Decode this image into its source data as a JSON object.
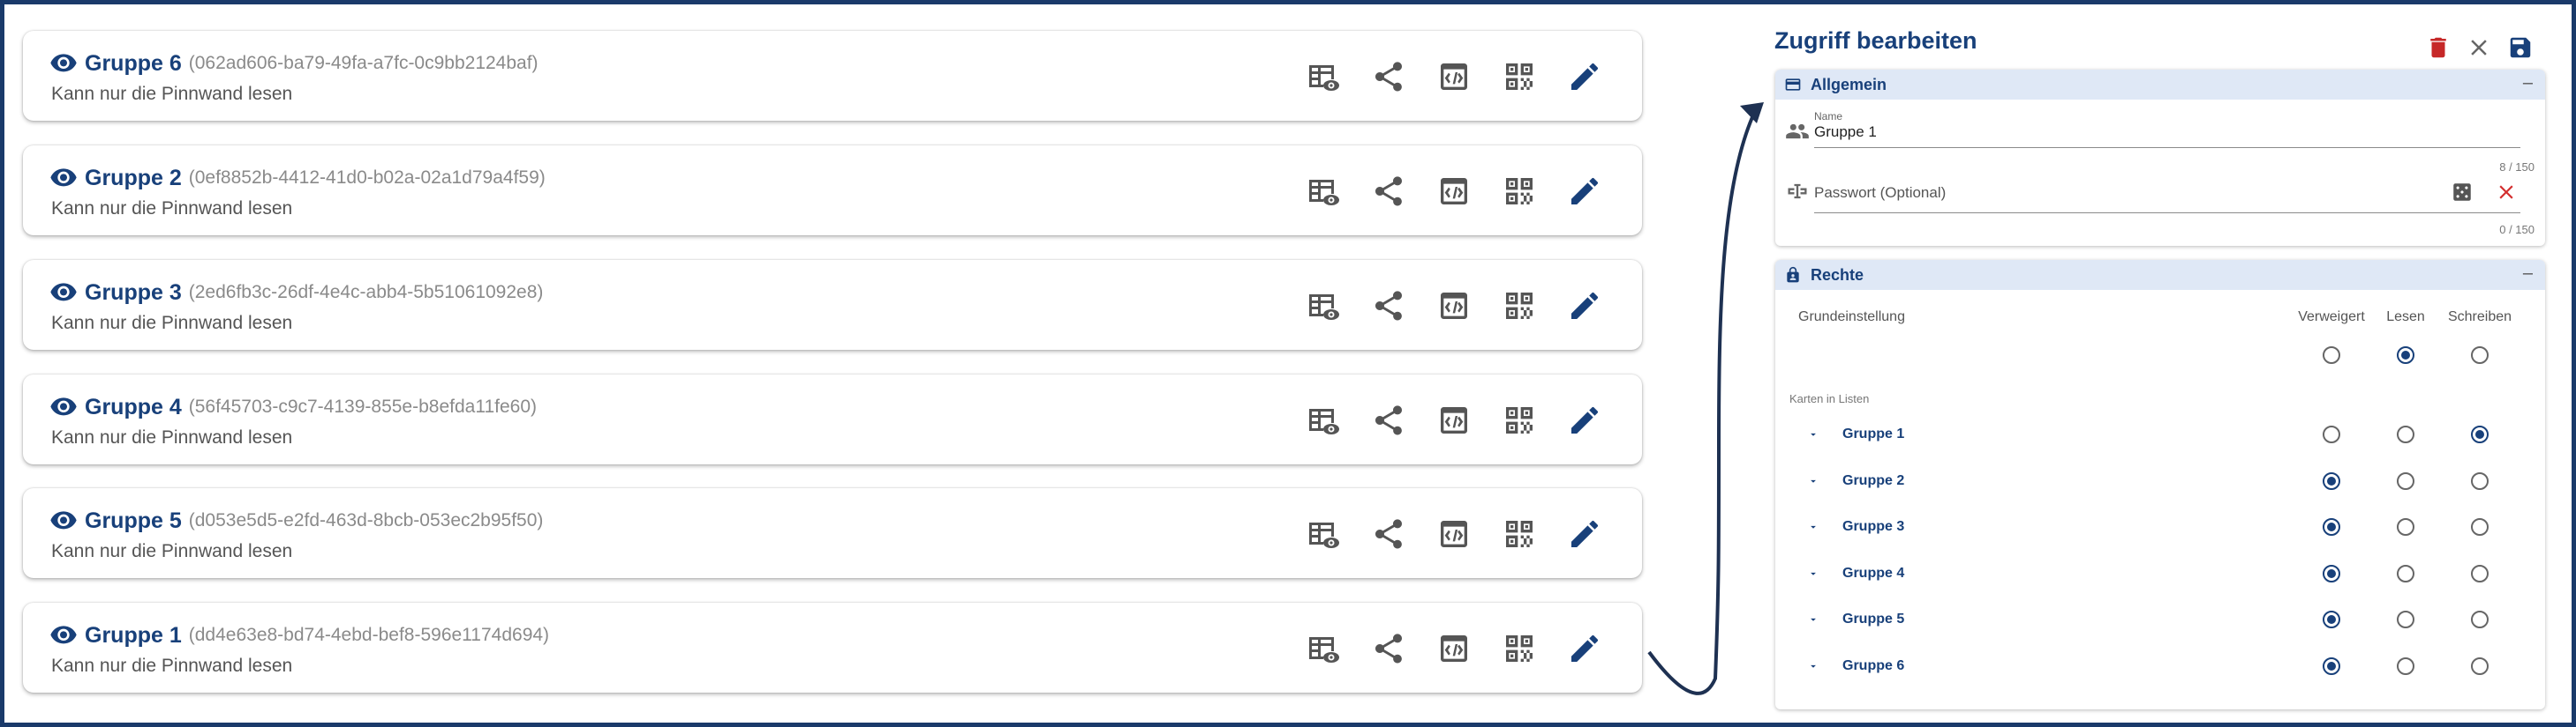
{
  "cards": [
    {
      "name": "Gruppe 6",
      "uuid": "(062ad606-ba79-49fa-a7fc-0c9bb2124baf)",
      "desc": "Kann nur die Pinnwand lesen"
    },
    {
      "name": "Gruppe 2",
      "uuid": "(0ef8852b-4412-41d0-b02a-02a1d79a4f59)",
      "desc": "Kann nur die Pinnwand lesen"
    },
    {
      "name": "Gruppe 3",
      "uuid": "(2ed6fb3c-26df-4e4c-abb4-5b51061092e8)",
      "desc": "Kann nur die Pinnwand lesen"
    },
    {
      "name": "Gruppe 4",
      "uuid": "(56f45703-c9c7-4139-855e-b8efda11fe60)",
      "desc": "Kann nur die Pinnwand lesen"
    },
    {
      "name": "Gruppe 5",
      "uuid": "(d053e5d5-e2fd-463d-8bcb-053ec2b95f50)",
      "desc": "Kann nur die Pinnwand lesen"
    },
    {
      "name": "Gruppe 1",
      "uuid": "(dd4e63e8-bd74-4ebd-bef8-596e1174d694)",
      "desc": "Kann nur die Pinnwand lesen"
    }
  ],
  "card_icons": [
    "table-eye-icon",
    "share-icon",
    "embed-code-icon",
    "qr-code-icon",
    "edit-pencil-icon"
  ],
  "panel": {
    "title": "Zugriff bearbeiten",
    "header_icons": [
      "delete-icon",
      "close-icon",
      "save-icon"
    ],
    "general": {
      "label": "Allgemein",
      "collapse": "–",
      "name_label": "Name",
      "name_value": "Gruppe 1",
      "name_counter": "8 / 150",
      "password_placeholder": "Passwort (Optional)",
      "password_counter": "0 / 150"
    },
    "rights": {
      "label": "Rechte",
      "collapse": "–",
      "default_label": "Grundeinstellung",
      "columns": [
        "Verweigert",
        "Lesen",
        "Schreiben"
      ],
      "default_selected": 1,
      "subheading": "Karten in Listen",
      "groups": [
        {
          "name": "Gruppe 1",
          "selected": 2
        },
        {
          "name": "Gruppe 2",
          "selected": 0
        },
        {
          "name": "Gruppe 3",
          "selected": 0
        },
        {
          "name": "Gruppe 4",
          "selected": 0
        },
        {
          "name": "Gruppe 5",
          "selected": 0
        },
        {
          "name": "Gruppe 6",
          "selected": 0
        }
      ]
    }
  },
  "colors": {
    "primary": "#18407a",
    "header_bg": "#dfe8f6",
    "icon_gray": "#555555",
    "delete_red": "#c62828",
    "clear_red": "#d32f2f",
    "frame_border": "#1a3a6a"
  }
}
